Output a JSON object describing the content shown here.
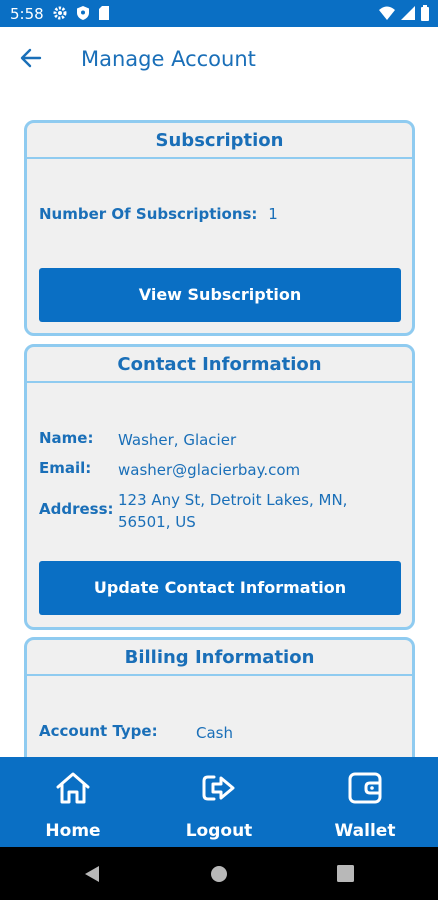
{
  "status_bar": {
    "time": "5:58",
    "icons": [
      "gear-icon",
      "shield-icon",
      "sd-card-icon",
      "wifi-icon",
      "signal-icon",
      "battery-icon"
    ]
  },
  "app_bar": {
    "title": "Manage Account",
    "back_icon": "arrow-left-icon"
  },
  "subscription": {
    "header": "Subscription",
    "count_label": "Number Of Subscriptions:",
    "count_value": "1",
    "button_label": "View Subscription"
  },
  "contact": {
    "header": "Contact Information",
    "name_label": "Name:",
    "name_value": "Washer, Glacier",
    "email_label": "Email:",
    "email_value": "washer@glacierbay.com",
    "address_label": "Address:",
    "address_value": "123 Any St, Detroit Lakes, MN, 56501, US",
    "button_label": "Update Contact Information"
  },
  "billing": {
    "header": "Billing Information",
    "account_type_label": "Account Type:",
    "account_type_value": "Cash"
  },
  "bottom_nav": {
    "items": [
      {
        "label": "Home",
        "icon": "home-icon"
      },
      {
        "label": "Logout",
        "icon": "logout-icon"
      },
      {
        "label": "Wallet",
        "icon": "wallet-icon"
      }
    ]
  },
  "colors": {
    "primary": "#0a6fc4",
    "text_blue": "#1a6fb8",
    "card_border": "#8fcbf0",
    "card_bg": "#f0f0f0"
  }
}
